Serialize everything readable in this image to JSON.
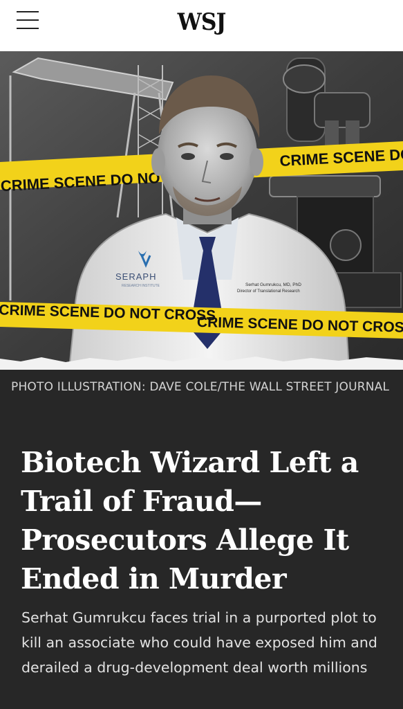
{
  "header": {
    "logo": "WSJ",
    "menu_icon": "hamburger-menu-icon"
  },
  "hero_image": {
    "tape_text_top": "CRIME SCENE DO NOT CROSS",
    "tape_text_bottom": "CRIME SCENE DO NOT CROSS",
    "coat_logo": "SERAPH",
    "coat_logo_sub": "RESEARCH INSTITUTE",
    "coat_name": "Serhat Gumrukcu, MD, PhD",
    "coat_title": "Director of Translational Research"
  },
  "article": {
    "photo_credit": "PHOTO ILLUSTRATION: DAVE COLE/THE WALL STREET JOURNAL",
    "headline": "Biotech Wizard Left a Trail of Fraud—Prosecutors Allege It Ended in Murder",
    "dek": "Serhat Gumrukcu faces trial in a purported plot to kill an associate who could have exposed him and derailed a drug-development deal worth millions"
  },
  "colors": {
    "background": "#272727",
    "header_bg": "#ffffff",
    "tape_yellow": "#f2d21a",
    "headline_text": "#ffffff"
  }
}
